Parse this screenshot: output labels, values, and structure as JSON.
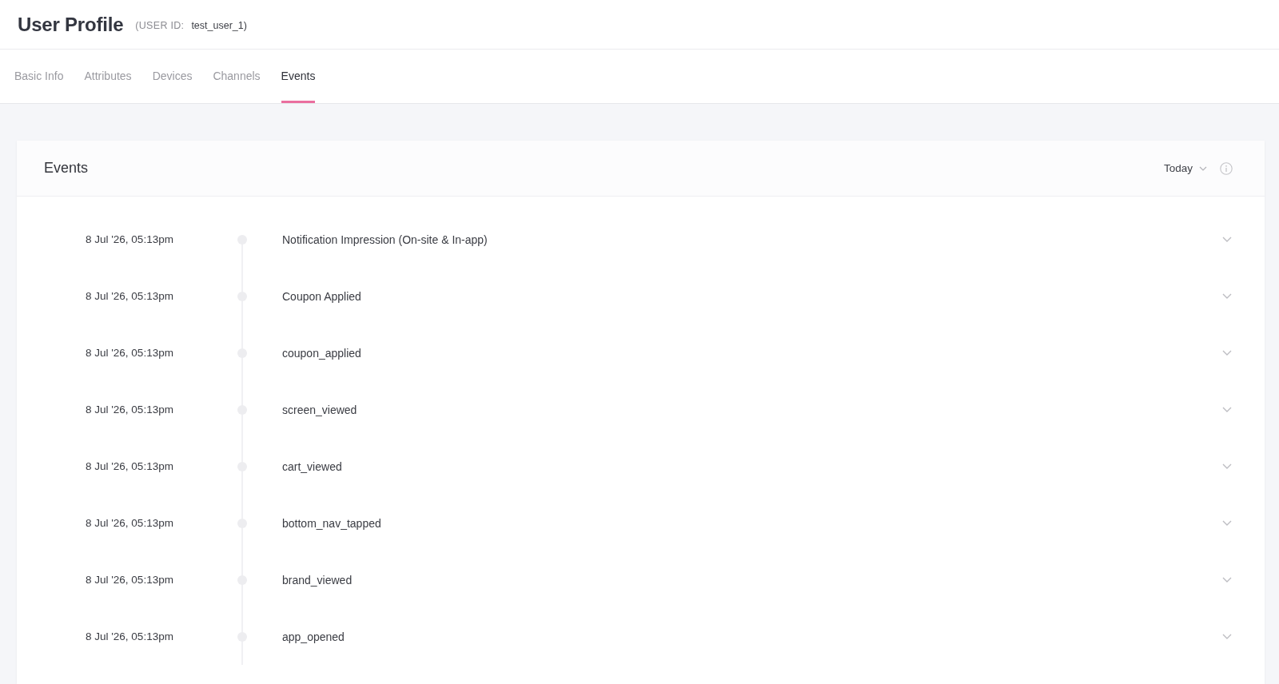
{
  "header": {
    "title": "User Profile",
    "user_id_label": "(USER ID:",
    "user_id": "test_user_1)"
  },
  "tabs": [
    {
      "label": "Basic Info",
      "selected": false
    },
    {
      "label": "Attributes",
      "selected": false
    },
    {
      "label": "Devices",
      "selected": false
    },
    {
      "label": "Channels",
      "selected": false
    },
    {
      "label": "Events",
      "selected": true
    }
  ],
  "events_card": {
    "title": "Events",
    "filter": "Today",
    "events": [
      {
        "time": "8 Jul '26, 05:13pm",
        "name": "Notification Impression (On-site & In-app)",
        "expanded": false
      },
      {
        "time": "8 Jul '26, 05:13pm",
        "name": "Coupon Applied",
        "expanded": false
      },
      {
        "time": "8 Jul '26, 05:13pm",
        "name": "coupon_applied",
        "expanded": false
      },
      {
        "time": "8 Jul '26, 05:13pm",
        "name": "screen_viewed",
        "expanded": false
      },
      {
        "time": "8 Jul '26, 05:13pm",
        "name": "cart_viewed",
        "expanded": false
      },
      {
        "time": "8 Jul '26, 05:13pm",
        "name": "bottom_nav_tapped",
        "expanded": false
      },
      {
        "time": "8 Jul '26, 05:13pm",
        "name": "brand_viewed",
        "expanded": false
      },
      {
        "time": "8 Jul '26, 05:13pm",
        "name": "app_opened",
        "expanded": false
      }
    ]
  }
}
